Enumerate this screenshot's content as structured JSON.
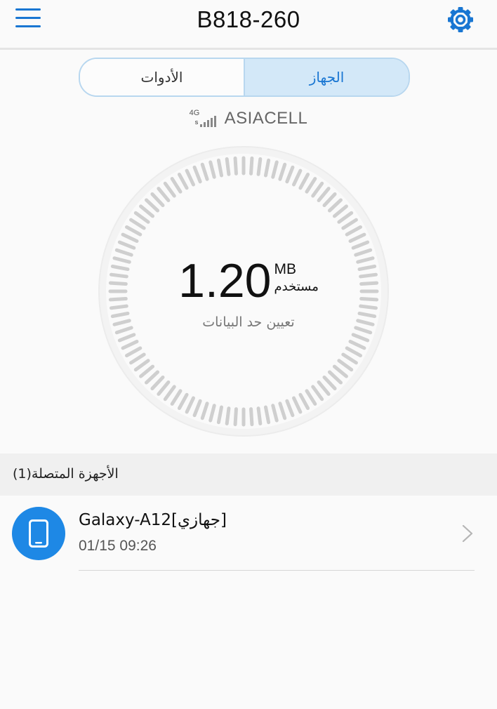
{
  "header": {
    "title": "B818-260",
    "menu_icon": "hamburger-menu-icon",
    "settings_icon": "gear-icon",
    "accent_color": "#1976d2"
  },
  "tabs": [
    {
      "label": "الأدوات",
      "selected": false
    },
    {
      "label": "الجهاز",
      "selected": true
    }
  ],
  "network": {
    "type": "4G",
    "sim_label": "S",
    "operator": "ASIACELL",
    "signal_icon": "signal-strength-icon"
  },
  "usage": {
    "value": "1.20",
    "unit": "MB",
    "label": "مستخدم",
    "set_limit_label": "تعيين حد البيانات"
  },
  "connected_devices": {
    "title": "الأجهزة المتصلة(1)",
    "items": [
      {
        "name": "Galaxy-A12[جهازي]",
        "time": "01/15 09:26",
        "icon": "smartphone-icon",
        "avatar_color": "#1e88e5"
      }
    ]
  }
}
